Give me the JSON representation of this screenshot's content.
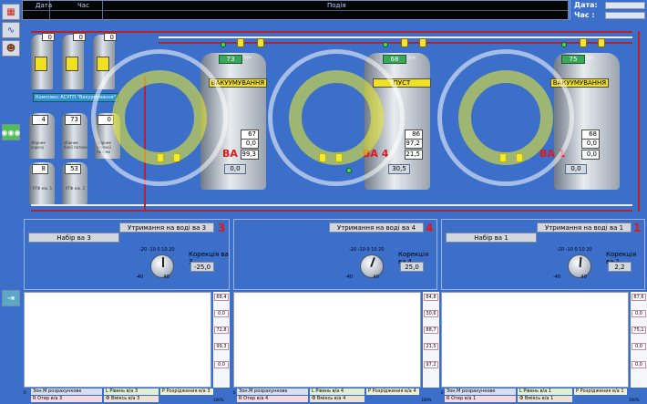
{
  "header": {
    "col_date": "Дата",
    "col_time": "Час",
    "col_event": "Подія"
  },
  "datetime": {
    "date_label": "Дата:",
    "time_label": "Час :"
  },
  "toolbar": {
    "icons": [
      "factory-icon",
      "chart-icon",
      "people-icon",
      "process-icon",
      "exit-icon"
    ]
  },
  "process": {
    "system_label": "Комплекс АСУТП \"Вакуумування\"",
    "tank3": {
      "level": "73",
      "unit": "т/ч",
      "status": "ВАКУУМУВАННЯ",
      "label": "ВА 3",
      "v1": "67",
      "v2": "0,0",
      "v3": "99,3",
      "bottom": "0,0"
    },
    "tank4": {
      "level": "68",
      "unit": "т/ч",
      "status": "ПУСТ",
      "label": "ВА 4",
      "v1": "86",
      "v2": "97,2",
      "v3": "21,5",
      "bottom": "30,5"
    },
    "tank1": {
      "level": "75",
      "unit": "т/ч",
      "status": "ВАКУУМУВАННЯ",
      "label": "ВА 1",
      "v1": "68",
      "v2": "0,0",
      "v3": "0,0",
      "bottom": "0,0"
    },
    "small_tanks": [
      {
        "label": "збірник сорозу",
        "value": "4"
      },
      {
        "label": "збірник білої патоки",
        "value": "73"
      },
      {
        "label": "збірник зеленої патоки",
        "value": "0"
      }
    ],
    "bottom_tanks": [
      {
        "label": "УТФ мік. 1",
        "value": "8"
      },
      {
        "label": "УТФ мік. 2",
        "value": "53"
      }
    ],
    "top_indicators": [
      "0",
      "0",
      "0"
    ]
  },
  "panels": [
    {
      "title": "Утримання на воді ва 3",
      "number": "3",
      "set_label": "Набір ва 3",
      "corr_label": "Корекція ва 3",
      "corr_value": "-25,0"
    },
    {
      "title": "Утримання на воді ва 4",
      "number": "4",
      "set_label": "",
      "corr_label": "Корекція ва 4",
      "corr_value": "25,0"
    },
    {
      "title": "Утримання на воді ва 1",
      "number": "1",
      "set_label": "Набір ва 1",
      "corr_label": "Корекція ва 1",
      "corr_value": "2,2"
    }
  ],
  "charts": [
    {
      "side": [
        "68,4",
        "0,0",
        "72,8",
        "99,3",
        "0,0"
      ],
      "legend": [
        "Зон.М розрахункове",
        "L Рівень в/а 3",
        "P Розріджения в/а 3",
        "R Отер в/а 3",
        "Ф Вміксь в/а 3"
      ],
      "scale_low": "0",
      "scale_high": "100%"
    },
    {
      "side": [
        "84,8",
        "30,6",
        "88,7",
        "21,5",
        "97,2"
      ],
      "legend": [
        "Зон.М розрахункове",
        "L Рівень в/а 4",
        "P Розріджения в/а 4",
        "R Отер в/а 4",
        "Ф Вміксь в/а 4"
      ],
      "scale_low": "0",
      "scale_high": "100%"
    },
    {
      "side": [
        "87,6",
        "0,0",
        "75,1",
        "0,0",
        "0,0"
      ],
      "legend": [
        "Зон.М розрахункове",
        "L Рівень в/а 1",
        "P Розріджения в/а 1",
        "R Отер в/а 1",
        "Ф Вміксь в/а 1"
      ],
      "scale_low": "0",
      "scale_high": "100%"
    }
  ],
  "colors": {
    "background": "#3b6fc9",
    "pipe_hot": "#c02020",
    "status_yellow": "#f0e020",
    "alarm_red": "#e01818"
  }
}
